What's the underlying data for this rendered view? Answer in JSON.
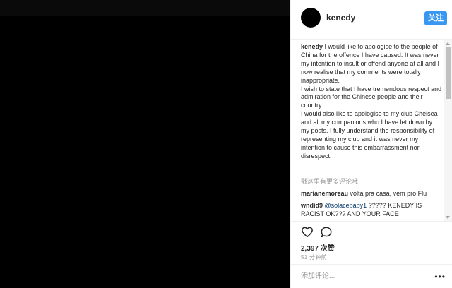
{
  "post": {
    "username": "kenedy",
    "follow_label": "关注"
  },
  "caption": {
    "author": "kenedy",
    "lines": [
      "I would like to apologise to the people of China for the offence I have caused. It was never my intention to insult or offend anyone at all and I now realise that my comments were totally inappropriate.",
      "I wish to state that I have tremendous respect and admiration for the Chinese people and their country.",
      "I would also like to apologise to my club Chelsea and all my companions who I have let down by my posts. I fully understand the responsibility of representing my club and it was never my intention to cause this embarrassment nor disrespect."
    ]
  },
  "comments": {
    "more_link": "戳这里有更多评论哦",
    "items": [
      {
        "author": "marianemoreau",
        "mention": "",
        "text": "volta pra casa, vem pro Flu"
      },
      {
        "author": "wndid9",
        "mention": "@solacebaby1",
        "text": "????? KENEDY IS RACIST OK??? AND YOUR FACE"
      }
    ]
  },
  "stats": {
    "likes": "2,397 次赞",
    "time": "51 分钟前"
  },
  "compose": {
    "placeholder": "添加评论...",
    "more": "•••"
  },
  "icons": {
    "like": "heart-icon",
    "comment": "comment-bubble-icon",
    "options": "more-options-icon"
  },
  "colors": {
    "follow_button": "#3897f0",
    "text": "#262626",
    "muted": "#999999",
    "mention": "#003569"
  }
}
